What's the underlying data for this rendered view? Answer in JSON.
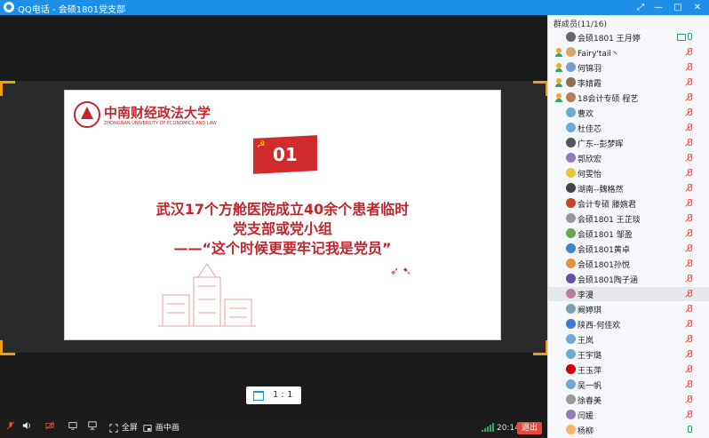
{
  "window": {
    "title": "QQ电话 - 会硕1801党支部",
    "controls": [
      "⤢",
      "—",
      "□",
      "✕"
    ]
  },
  "slide": {
    "university_name": "中南财经政法大学",
    "university_en": "ZHONGNAN UNIVERSITY OF ECONOMICS AND LAW",
    "badge_number": "01",
    "line1": "武汉17个方舱医院成立40余个患者临时",
    "line2": "党支部或党小组",
    "line3": "——“这个时候更要牢记我是党员”"
  },
  "ratio_button": {
    "label": "1 : 1"
  },
  "members_panel": {
    "header": "群成员(11/16)",
    "members": [
      {
        "name": "会硕1801 王月婷",
        "pinned": false,
        "mic": "on",
        "screen": true,
        "selected": false,
        "avatar": "#666"
      },
      {
        "name": "Fairy'tail丶",
        "pinned": true,
        "mic": "off",
        "screen": false,
        "selected": false,
        "avatar": "#d9a66b"
      },
      {
        "name": "何锦羽",
        "pinned": true,
        "mic": "off",
        "screen": false,
        "selected": false,
        "avatar": "#7a9ccf"
      },
      {
        "name": "李婧霞",
        "pinned": true,
        "mic": "off",
        "screen": false,
        "selected": false,
        "avatar": "#8c6f5a"
      },
      {
        "name": "18会计专硕 程艺",
        "pinned": true,
        "mic": "off",
        "screen": false,
        "selected": false,
        "avatar": "#b57d5b"
      },
      {
        "name": "曹欢",
        "pinned": false,
        "mic": "off",
        "screen": false,
        "selected": false,
        "avatar": "#6fa8dc"
      },
      {
        "name": "杜佳芯",
        "pinned": false,
        "mic": "off",
        "screen": false,
        "selected": false,
        "avatar": "#6fa8dc"
      },
      {
        "name": "广东--彭梦晖",
        "pinned": false,
        "mic": "off",
        "screen": false,
        "selected": false,
        "avatar": "#555"
      },
      {
        "name": "郭欣宏",
        "pinned": false,
        "mic": "off",
        "screen": false,
        "selected": false,
        "avatar": "#8e7cc3"
      },
      {
        "name": "何雯怡",
        "pinned": false,
        "mic": "off",
        "screen": false,
        "selected": false,
        "avatar": "#f1c232"
      },
      {
        "name": "湖南--魏格然",
        "pinned": false,
        "mic": "off",
        "screen": false,
        "selected": false,
        "avatar": "#444"
      },
      {
        "name": "会计专硕 滕婉君",
        "pinned": false,
        "mic": "off",
        "screen": false,
        "selected": false,
        "avatar": "#cc4125"
      },
      {
        "name": "会硕1801 王芷琰",
        "pinned": false,
        "mic": "off",
        "screen": false,
        "selected": false,
        "avatar": "#999"
      },
      {
        "name": "会硕1801 邹盈",
        "pinned": false,
        "mic": "off",
        "screen": false,
        "selected": false,
        "avatar": "#6aa84f"
      },
      {
        "name": "会硕1801黄卓",
        "pinned": false,
        "mic": "off",
        "screen": false,
        "selected": false,
        "avatar": "#3d85c6"
      },
      {
        "name": "会硕1801孙悦",
        "pinned": false,
        "mic": "off",
        "screen": false,
        "selected": false,
        "avatar": "#e69138"
      },
      {
        "name": "会硕1801陶子涵",
        "pinned": false,
        "mic": "off",
        "screen": false,
        "selected": false,
        "avatar": "#674ea7"
      },
      {
        "name": "李漫",
        "pinned": false,
        "mic": "off",
        "screen": false,
        "selected": true,
        "avatar": "#c27ba0"
      },
      {
        "name": "阚婷琪",
        "pinned": false,
        "mic": "off",
        "screen": false,
        "selected": false,
        "avatar": "#76a5af"
      },
      {
        "name": "陕西-何佳欢",
        "pinned": false,
        "mic": "off",
        "screen": false,
        "selected": false,
        "avatar": "#3c78d8"
      },
      {
        "name": "王岚",
        "pinned": false,
        "mic": "off",
        "screen": false,
        "selected": false,
        "avatar": "#6fa8dc"
      },
      {
        "name": "王宇璐",
        "pinned": false,
        "mic": "off",
        "screen": false,
        "selected": false,
        "avatar": "#6fa8dc"
      },
      {
        "name": "王玉萍",
        "pinned": false,
        "mic": "off",
        "screen": false,
        "selected": false,
        "avatar": "#cc0000"
      },
      {
        "name": "吴一帆",
        "pinned": false,
        "mic": "off",
        "screen": false,
        "selected": false,
        "avatar": "#6fa8dc"
      },
      {
        "name": "徐春美",
        "pinned": false,
        "mic": "off",
        "screen": false,
        "selected": false,
        "avatar": "#999"
      },
      {
        "name": "闫媛",
        "pinned": false,
        "mic": "off",
        "screen": false,
        "selected": false,
        "avatar": "#8e7cc3"
      },
      {
        "name": "杨柳",
        "pinned": false,
        "mic": "on",
        "screen": false,
        "selected": false,
        "avatar": "#f6b26b"
      }
    ]
  },
  "toolbar": {
    "fullscreen_label": "全屏",
    "pip_label": "画中画",
    "time": "20:14",
    "exit_label": "退出"
  }
}
